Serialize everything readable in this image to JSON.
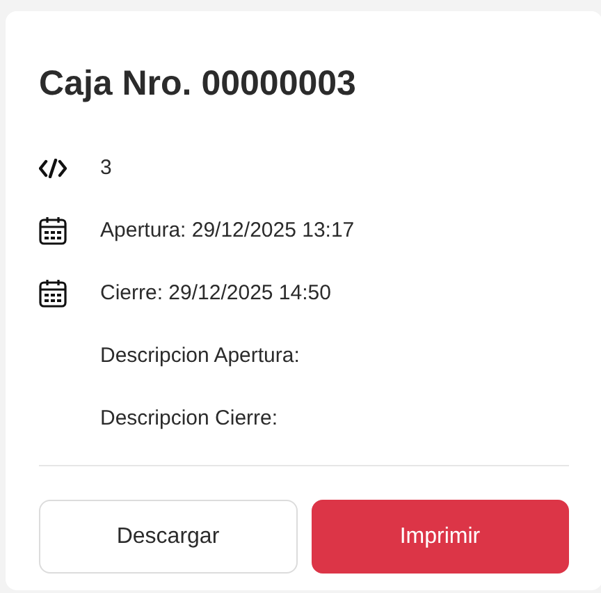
{
  "title": "Caja Nro. 00000003",
  "details": [
    {
      "kind": "code",
      "text": "3"
    },
    {
      "kind": "calendar",
      "text": "Apertura: 29/12/2025 13:17"
    },
    {
      "kind": "calendar",
      "text": "Cierre: 29/12/2025 14:50"
    },
    {
      "kind": "none",
      "text": "Descripcion Apertura:"
    },
    {
      "kind": "none",
      "text": "Descripcion Cierre:"
    }
  ],
  "buttons": [
    {
      "label": "Descargar",
      "kind": "outline"
    },
    {
      "label": "Imprimir",
      "kind": "primary"
    }
  ]
}
